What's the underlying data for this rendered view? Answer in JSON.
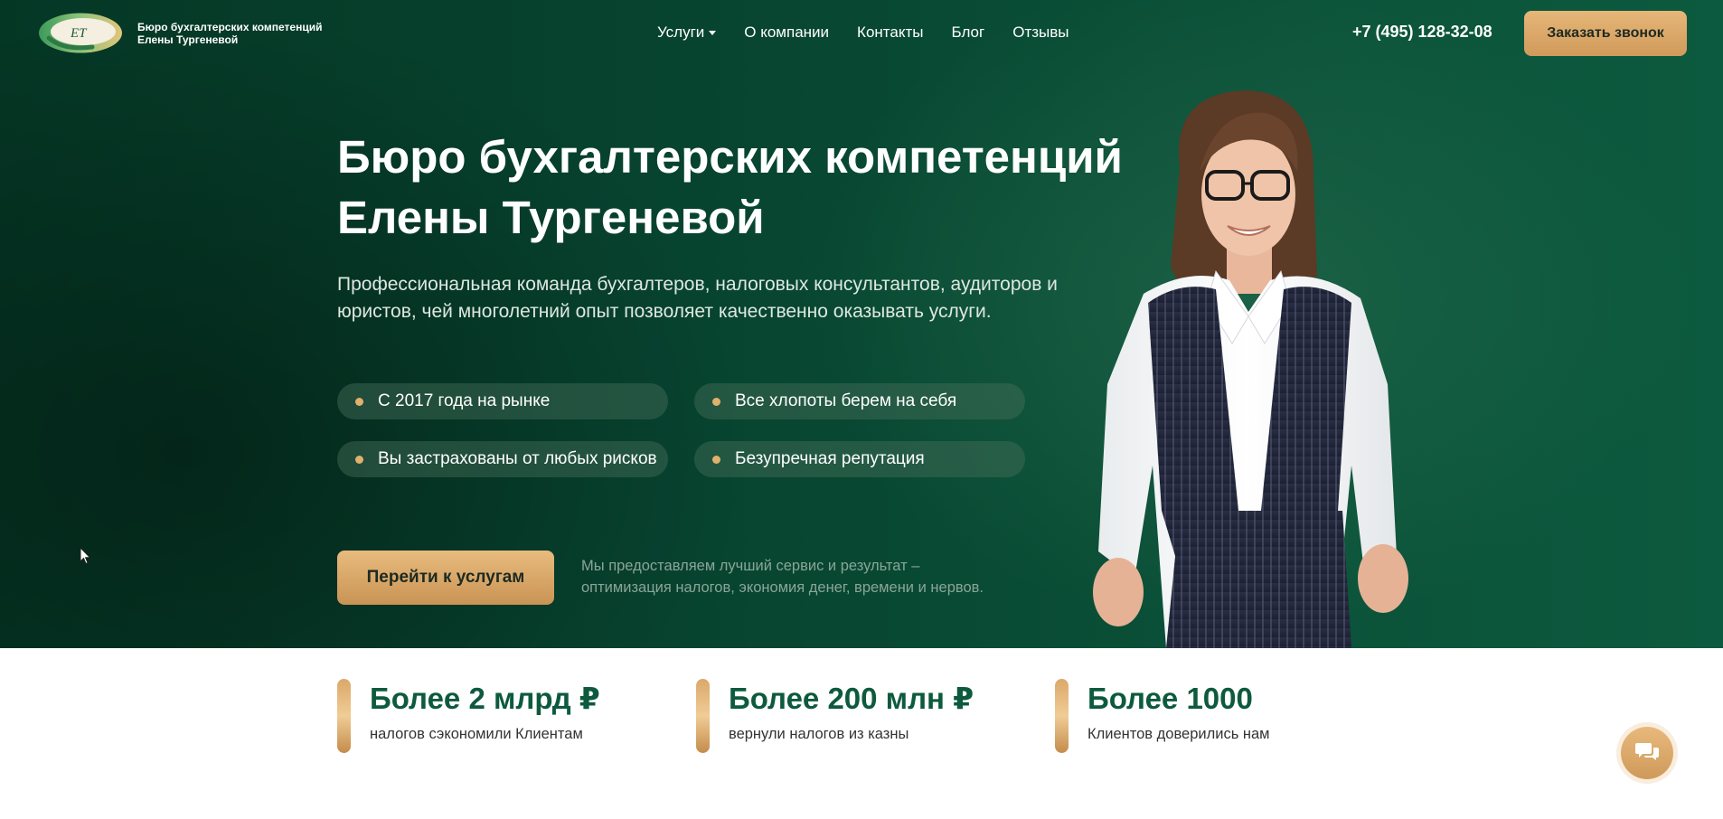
{
  "header": {
    "logo_monogram": "ЕТ",
    "logo_line1": "Бюро бухгалтерских компетенций",
    "logo_line2": "Елены Тургеневой",
    "nav": [
      {
        "label": "Услуги",
        "has_dropdown": true
      },
      {
        "label": "О компании"
      },
      {
        "label": "Контакты"
      },
      {
        "label": "Блог"
      },
      {
        "label": "Отзывы"
      }
    ],
    "phone": "+7 (495) 128-32-08",
    "call_button": "Заказать звонок"
  },
  "hero": {
    "title_line1": "Бюро бухгалтерских компетенций",
    "title_line2": "Елены Тургеневой",
    "subtitle_line1": "Профессиональная команда бухгалтеров, налоговых консультантов, аудиторов и",
    "subtitle_line2": "юристов, чей многолетний опыт позволяет качественно оказывать услуги.",
    "features": [
      "С 2017 года на рынке",
      "Все хлопоты берем на себя",
      "Вы застрахованы от любых рисков",
      "Безупречная репутация"
    ],
    "cta_button": "Перейти к услугам",
    "cta_note_line1": "Мы предоставляем лучший сервис и результат –",
    "cta_note_line2": "оптимизация налогов, экономия денег, времени и нервов."
  },
  "stats": [
    {
      "value": "Более 2 млрд ₽",
      "label": "налогов сэкономили Клиентам"
    },
    {
      "value": "Более 200 млн ₽",
      "label": "вернули налогов из казны"
    },
    {
      "value": "Более 1000",
      "label": "Клиентов доверились нам"
    }
  ],
  "colors": {
    "hero_green": "#074430",
    "accent_gold": "#e0b16c",
    "stat_green": "#0d5a3e"
  },
  "icons": {
    "chat": "chat-bubbles-icon",
    "cursor": "mouse-pointer-icon"
  }
}
